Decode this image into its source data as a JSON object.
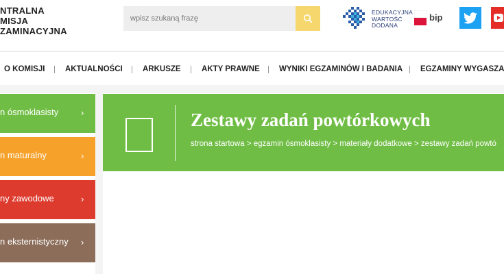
{
  "header": {
    "logo_lines": [
      "NTRALNA",
      "MISJA",
      "ZAMINACYJNA"
    ],
    "search_placeholder": "wpisz szukaną frazę",
    "ewd_lines": [
      "EDUKACYJNA",
      "WARTOŚĆ",
      "DODANA"
    ],
    "bip_label": "bip"
  },
  "nav": {
    "items": [
      "O KOMISJI",
      "AKTUALNOŚCI",
      "ARKUSZE",
      "AKTY PRAWNE",
      "WYNIKI EGZAMINÓW I BADANIA",
      "EGZAMINY WYGASZANE"
    ]
  },
  "sidebar": {
    "items": [
      {
        "label": "n ósmoklasisty",
        "color": "#70bd45"
      },
      {
        "label": "n maturalny",
        "color": "#f5a12a"
      },
      {
        "label": "ny zawodowe",
        "color": "#dd3b2e"
      },
      {
        "label": "n eksternistyczny",
        "color": "#8c6d5a"
      }
    ],
    "chevron": "›"
  },
  "banner": {
    "title": "Zestawy zadań powtórkowych",
    "breadcrumb": [
      "strona startowa",
      "egzamin ósmoklasisty",
      "materiały dodatkowe",
      "zestawy zadań powtó"
    ],
    "breadcrumb_sep": " > ",
    "color": "#70bd45"
  },
  "colors": {
    "search_button": "#f5d76e",
    "twitter": "#1da1f2",
    "youtube": "#e52d27"
  }
}
